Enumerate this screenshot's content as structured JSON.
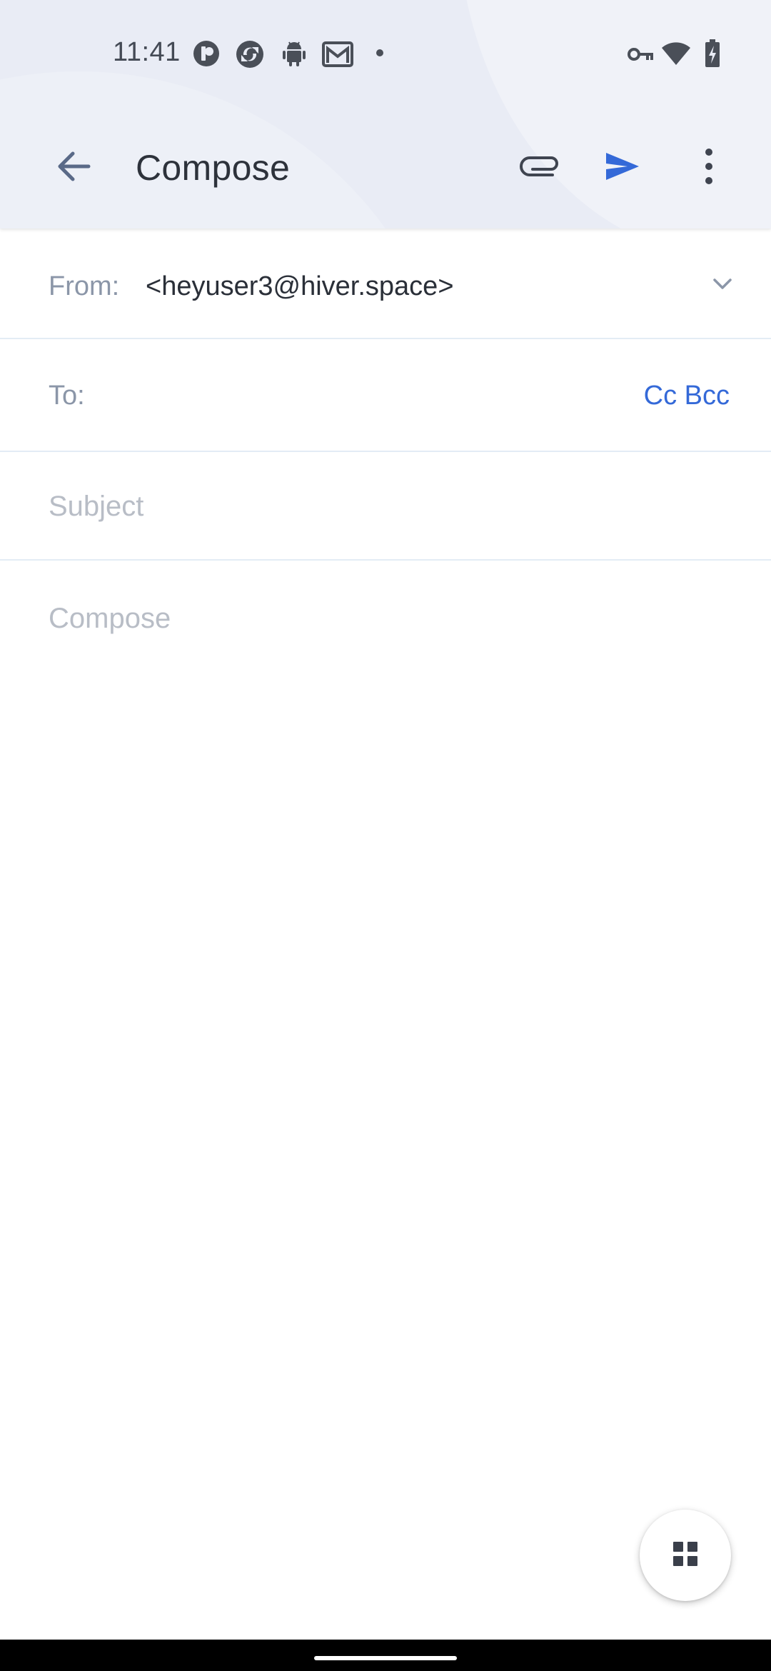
{
  "status_bar": {
    "time": "11:41",
    "left_icons": [
      "record-icon",
      "sync-icon",
      "android-icon",
      "gmail-icon",
      "dot-icon"
    ],
    "right_icons": [
      "vpn-key-icon",
      "wifi-icon",
      "battery-charging-icon"
    ]
  },
  "app_bar": {
    "title": "Compose",
    "actions": [
      "attach-icon",
      "send-icon",
      "more-vert-icon"
    ]
  },
  "compose": {
    "from_label": "From:",
    "from_value": "<heyuser3@hiver.space>",
    "to_label": "To:",
    "to_value": "",
    "cc_bcc_label": "Cc Bcc",
    "subject_placeholder": "Subject",
    "subject_value": "",
    "body_placeholder": "Compose",
    "body_value": ""
  },
  "fab": {
    "icon": "apps-grid-icon"
  },
  "colors": {
    "header_bg": "#e9ecf5",
    "accent_blue": "#3469d8",
    "label_gray": "#8b96a8",
    "placeholder_gray": "#b8bdc6",
    "divider": "#e3ecf5",
    "nav_bar": "#000000"
  }
}
